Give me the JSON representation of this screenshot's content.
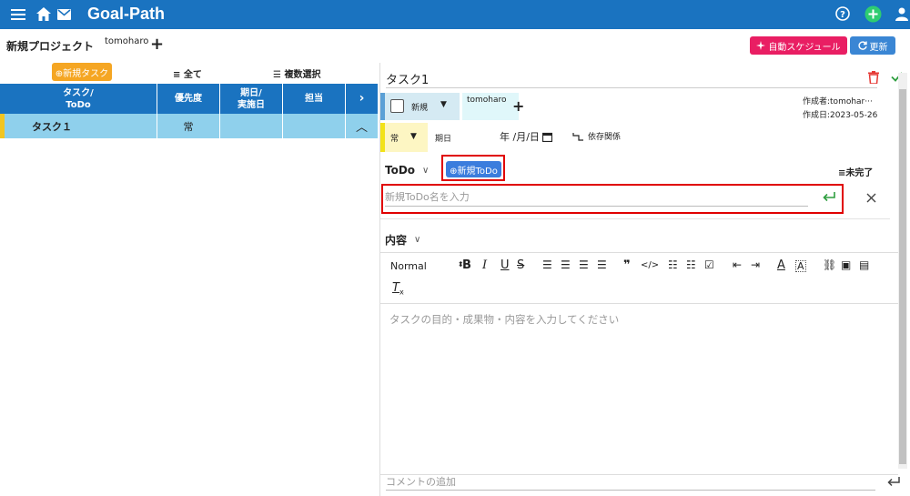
{
  "header": {
    "app_name": "Goal-Path"
  },
  "project": {
    "title": "新規プロジェクト",
    "user": "tomoharo",
    "auto_schedule_label": "自動スケジュール",
    "refresh_label": "更新"
  },
  "task_list": {
    "new_task_label": "⊕新規タスク",
    "filter_label": "全て",
    "multi_select_label": "複数選択",
    "columns": [
      "タスク/",
      "ToDo",
      "優先度",
      "期日/",
      "実施日",
      "担当"
    ],
    "rows": [
      {
        "name": "タスク１",
        "priority": "常"
      }
    ]
  },
  "detail": {
    "task_name": "タスク1",
    "status": "新規",
    "assignee": "tomoharo",
    "creator": "作成者:tomohar···",
    "created_date": "作成日:2023-05-26",
    "priority": "常",
    "due_label": "期日",
    "date_placeholder": "年 /月/日",
    "dependency_label": "依存関係",
    "todo_heading": "ToDo",
    "new_todo_label": "⊕新規ToDo",
    "incomplete_filter": "未完了",
    "todo_placeholder": "新規ToDo名を入力",
    "content_heading": "内容",
    "editor_format": "Normal",
    "content_placeholder": "タスクの目的・成果物・内容を入力してください",
    "comment_placeholder": "コメントの追加"
  },
  "colors": {
    "brand_blue": "#1a73c0",
    "row_selected": "#8fd0ec",
    "accent_pink": "#e91e63",
    "accent_orange": "#f5a623",
    "highlight_red": "#e00000",
    "confirm_green": "#2e9e3f"
  }
}
